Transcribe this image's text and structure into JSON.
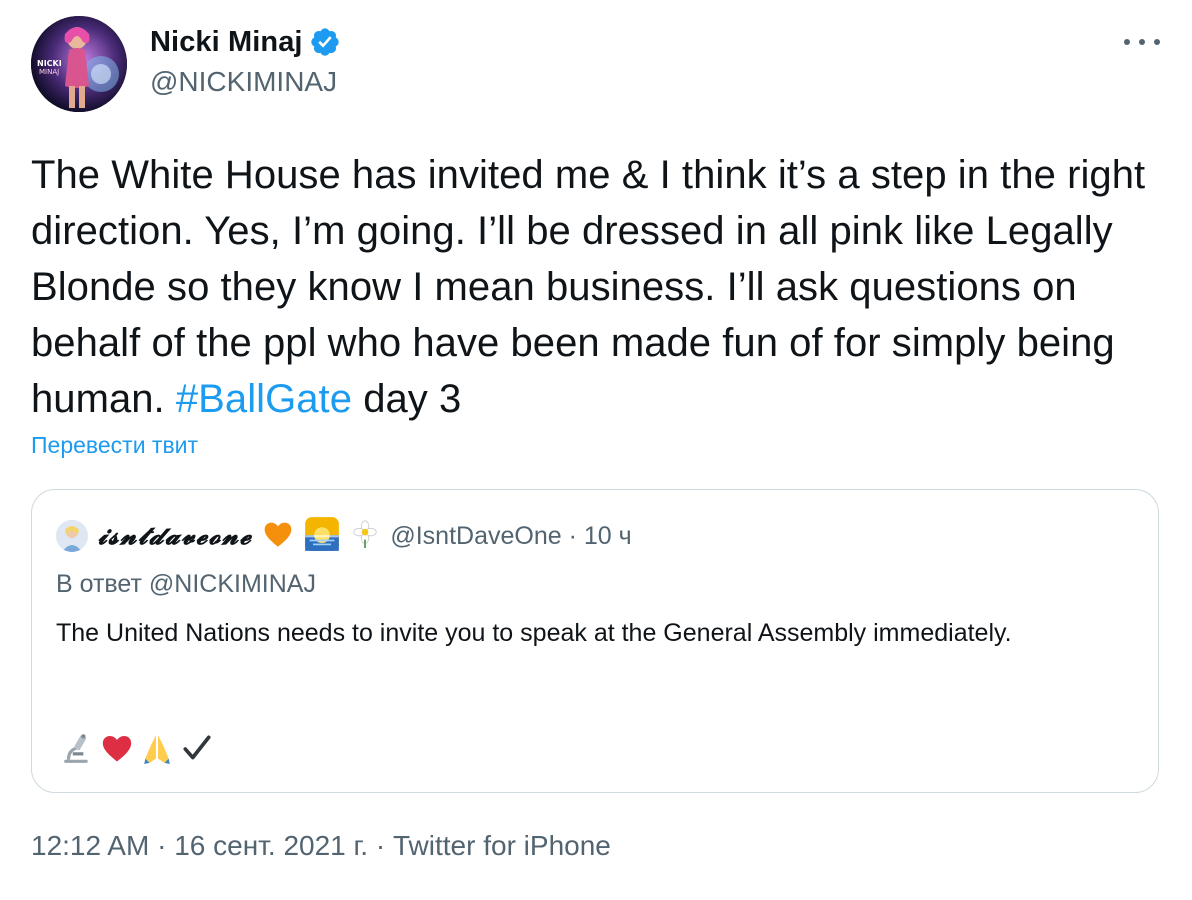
{
  "author": {
    "display_name": "Nicki Minaj",
    "handle": "@NICKIMINAJ",
    "verified": true,
    "avatar_icon": "profile-photo-icon",
    "avatar_text": [
      "NICKI",
      "MINAJ"
    ]
  },
  "more_menu_icon": "ellipsis-icon",
  "tweet": {
    "text_before_hashtag": "The White House has invited me & I think it’s a step in the right direction. Yes, I’m going. I’ll be dressed in all pink like Legally Blonde so they know I mean business. I’ll ask questions on behalf of the ppl who have been made fun of for simply being human.",
    "hashtag": "#BallGate",
    "text_after_hashtag": "day 3"
  },
  "translate_label": "Перевести твит",
  "quoted_tweet": {
    "display_name": "𝓲𝓼𝓷𝓽𝓭𝓪𝓿𝓮𝓸𝓷𝓮",
    "display_name_plain": "isntdaveone",
    "name_emojis": [
      "orange-heart-icon",
      "sunrise-icon",
      "white-flower-icon"
    ],
    "handle": "@IsntDaveOne",
    "separator": "·",
    "time": "10 ч",
    "reply_to": "В ответ @NICKIMINAJ",
    "text": "The United Nations needs to invite you to speak at the General Assembly immediately.",
    "emoji_row": [
      "microscope-icon",
      "red-heart-icon",
      "folded-hands-icon",
      "check-mark-icon"
    ]
  },
  "footer": {
    "time": "12:12 AM",
    "dot1": "·",
    "date": "16 сент. 2021 г.",
    "dot2": "·",
    "source": "Twitter for iPhone"
  },
  "colors": {
    "text_primary": "#0f1419",
    "text_secondary": "#536471",
    "link": "#1d9bf0",
    "border": "#cfd9de",
    "verified_badge": "#1d9bf0"
  }
}
